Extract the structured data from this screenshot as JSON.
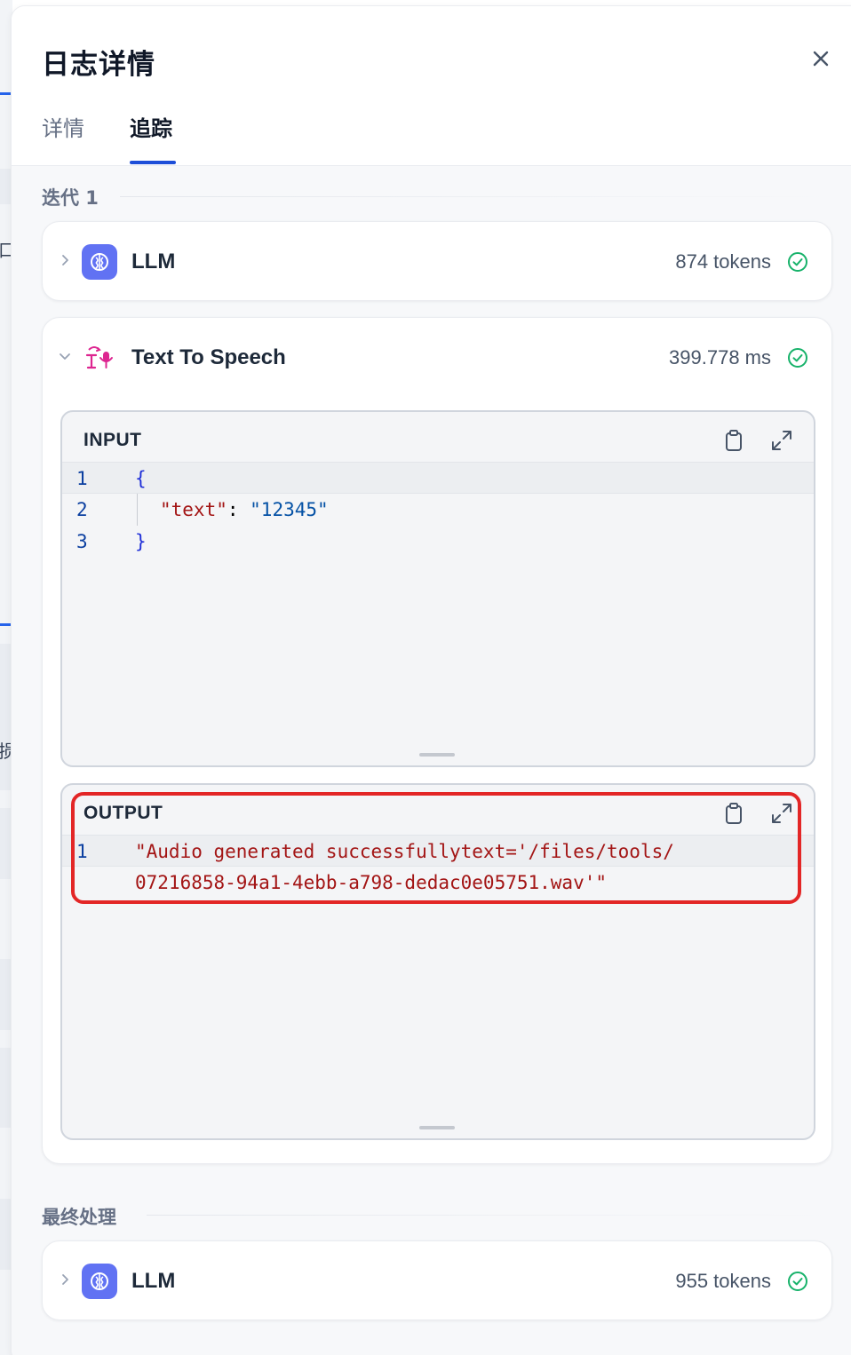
{
  "drawer": {
    "title": "日志详情",
    "tabs": [
      {
        "label": "详情",
        "active": false
      },
      {
        "label": "追踪",
        "active": true
      }
    ]
  },
  "background_page": {
    "glyphs": [
      "口:",
      "损"
    ]
  },
  "sections": {
    "iteration": {
      "label": "迭代 1",
      "llm_node": {
        "name": "LLM",
        "metric": "874 tokens",
        "status": "success",
        "icon": "llm-brain-icon"
      },
      "tts_node": {
        "name": "Text To Speech",
        "metric": "399.778 ms",
        "status": "success",
        "icon": "text-to-speech-icon",
        "input": {
          "title": "INPUT",
          "lines": {
            "l1": {
              "num": "1",
              "brace": "{"
            },
            "l2": {
              "num": "2",
              "key": "\"text\"",
              "colon": ": ",
              "value": "\"12345\""
            },
            "l3": {
              "num": "3",
              "brace": "}"
            }
          }
        },
        "output": {
          "title": "OUTPUT",
          "line_number": "1",
          "line_a": "\"Audio generated successfullytext='/files/tools/",
          "line_b": "07216858-94a1-4ebb-a798-dedac0e05751.wav'\""
        }
      }
    },
    "final": {
      "label": "最终处理",
      "llm_node": {
        "name": "LLM",
        "metric": "955 tokens",
        "status": "success",
        "icon": "llm-brain-icon"
      }
    }
  },
  "colors": {
    "accent": "#1d4ed8",
    "llm_icon_bg": "#6172f3",
    "success": "#17b26a",
    "tts_icon": "#dd2590",
    "annotation_red": "#e32626"
  }
}
